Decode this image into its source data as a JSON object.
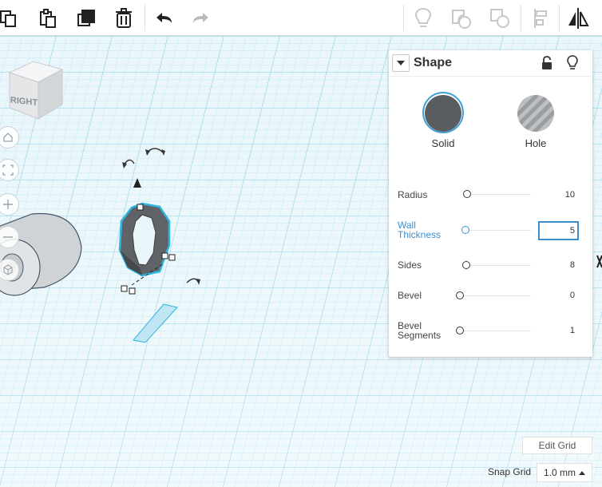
{
  "toolbar": {
    "left_tools": [
      "copy-icon",
      "paste-icon",
      "duplicate-icon",
      "delete-icon",
      "undo-icon",
      "redo-icon"
    ],
    "right_tools": [
      "show-hide-icon",
      "group-icon",
      "ungroup-icon",
      "align-icon",
      "mirror-icon"
    ]
  },
  "viewcube": {
    "face_label": "RIGHT"
  },
  "nav_buttons": [
    "home-icon",
    "fit-view-icon",
    "zoom-in-icon",
    "zoom-out-icon",
    "perspective-icon"
  ],
  "shape_panel": {
    "title": "Shape",
    "modes": {
      "solid_label": "Solid",
      "hole_label": "Hole",
      "selected": "Solid"
    },
    "properties": {
      "radius": {
        "label": "Radius",
        "value": "10",
        "level": 0.02
      },
      "wall_thickness": {
        "label_line1": "Wall",
        "label_line2": "Thickness",
        "value": "5",
        "level": 0.0
      },
      "sides": {
        "label": "Sides",
        "value": "8",
        "level": 0.0
      },
      "bevel": {
        "label": "Bevel",
        "value": "0",
        "level": 0.0
      },
      "bevel_segments": {
        "label_line1": "Bevel",
        "label_line2": "Segments",
        "value": "1",
        "level": 0.0
      }
    }
  },
  "grid_controls": {
    "edit_grid_label": "Edit Grid",
    "snap_grid_label": "Snap Grid",
    "snap_grid_value": "1.0 mm"
  },
  "colors": {
    "accent": "#3c8fce",
    "grid_line": "#8fd6ea",
    "workplane": "#e3f3f8",
    "selection": "#2eb6e0",
    "solid_swatch": "#5a5d60"
  }
}
